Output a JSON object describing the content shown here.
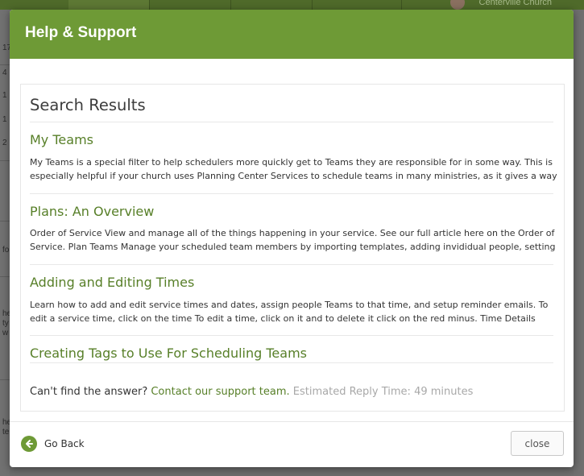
{
  "background": {
    "church_name": "Centerville Church",
    "left_fragments": [
      "17",
      "4",
      "1",
      "1",
      "2",
      "fo",
      "he",
      "ty",
      "w",
      "he",
      "te"
    ]
  },
  "modal": {
    "title": "Help & Support",
    "results_heading": "Search Results",
    "results": [
      {
        "title": "My Teams",
        "lines": [
          "My Teams is a special filter to help schedulers more quickly get to Teams they are responsible for in some way. This is",
          "especially helpful if your church uses Planning Center Services to schedule teams in many ministries, as it gives a way"
        ]
      },
      {
        "title": "Plans: An Overview",
        "lines": [
          "Order of Service View and manage all of the things happening in your service. See our full article here on the Order of",
          "Service. Plan Teams Manage your scheduled team members by importing templates, adding invididual people, setting"
        ]
      },
      {
        "title": "Adding and Editing Times",
        "lines": [
          "Learn how to add and edit service times and dates, assign people Teams to that time, and setup reminder emails. To",
          "edit a service time, click on the time To edit a time, click on it and to delete it click on the red minus. Time Details"
        ]
      },
      {
        "title": "Creating Tags to Use For Scheduling Teams",
        "lines": []
      }
    ],
    "footer": {
      "question": "Can't find the answer?",
      "contact_link": "Contact our support team.",
      "estimate": "Estimated Reply Time: 49 minutes"
    },
    "go_back_label": "Go Back",
    "close_label": "close"
  },
  "colors": {
    "accent": "#6e9a36",
    "link": "#577f28",
    "muted": "#a8a8a8"
  },
  "icons": {
    "go_back": "arrow-left-circle-icon"
  }
}
